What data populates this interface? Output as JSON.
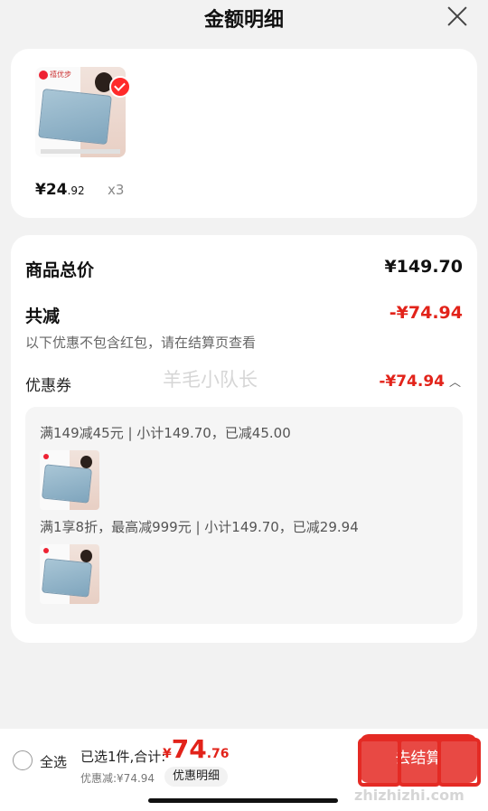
{
  "header": {
    "title": "金额明细"
  },
  "product": {
    "price_int": "¥24",
    "price_dec": ".92",
    "quantity": "x3",
    "brand_text": "禧优步"
  },
  "summary": {
    "total_label": "商品总价",
    "total_value": "¥149.70",
    "reduce_label": "共减",
    "reduce_value": "-¥74.94",
    "note": "以下优惠不包含红包，请在结算页查看",
    "coupon_label": "优惠券",
    "coupon_value": "-¥74.94",
    "coupon_lines": [
      "满149减45元 | 小计149.70，已减45.00",
      "满1享8折，最高减999元 | 小计149.70，已减29.94"
    ]
  },
  "watermark": "羊毛小队长",
  "bottom": {
    "select_all": "全选",
    "selected_text": "已选1件,合计:",
    "currency": "¥",
    "total_int": "74",
    "total_dec": ".76",
    "discount_text": "优惠减:¥74.94",
    "detail_button": "优惠明细",
    "checkout": "去结算",
    "site_url": "zhizhizhi.com"
  },
  "colors": {
    "accent_red": "#e2231a",
    "background": "#f2f2f2"
  }
}
